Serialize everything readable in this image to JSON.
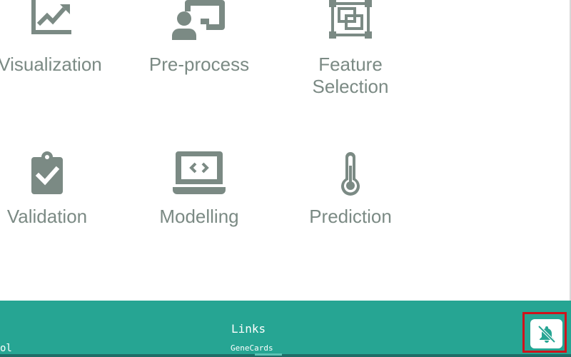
{
  "tiles": [
    {
      "label": "Visualization",
      "icon": "line-chart-icon"
    },
    {
      "label": "Pre-process",
      "icon": "presenter-board-icon"
    },
    {
      "label": "Feature Selection",
      "label_line1": "Feature",
      "label_line2": "Selection",
      "icon": "select-object-icon"
    },
    {
      "label": "Validation",
      "icon": "clipboard-check-icon"
    },
    {
      "label": "Modelling",
      "icon": "laptop-code-icon"
    },
    {
      "label": "Prediction",
      "icon": "thermometer-icon"
    }
  ],
  "footer": {
    "left_text": "ol",
    "links_title": "Links",
    "links": [
      "GeneCards"
    ]
  },
  "notification_button": {
    "icon": "bell-slash-icon"
  },
  "colors": {
    "icon_gray": "#7b8a84",
    "footer_teal": "#26a593",
    "highlight_red": "#d0121b"
  }
}
